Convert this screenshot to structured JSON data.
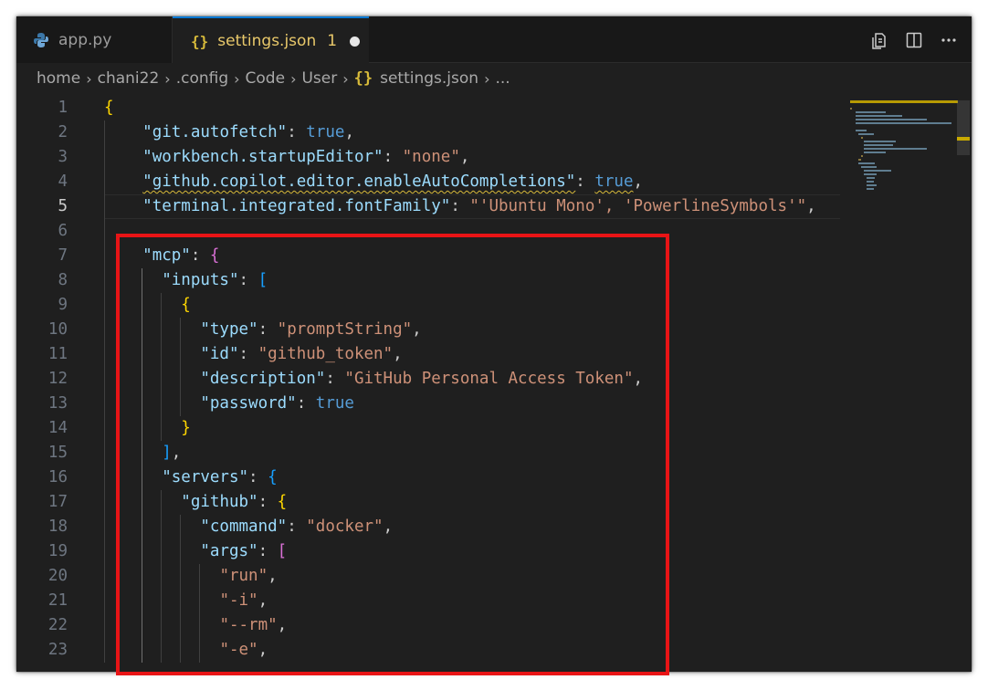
{
  "tabs": [
    {
      "label": "app.py",
      "icon": "python-icon",
      "active": false
    },
    {
      "label": "settings.json",
      "icon": "json-braces-icon",
      "problem_count": "1",
      "active": true,
      "dirty": true
    }
  ],
  "tab_actions": [
    "open-changes-icon",
    "split-editor-icon",
    "more-actions-icon"
  ],
  "breadcrumb": {
    "items": [
      "home",
      "chani22",
      ".config",
      "Code",
      "User"
    ],
    "file_icon": "{}",
    "file": "settings.json",
    "trailing": "..."
  },
  "editor": {
    "active_line": 5,
    "line_numbers": [
      "1",
      "2",
      "3",
      "4",
      "5",
      "6",
      "7",
      "8",
      "9",
      "10",
      "11",
      "12",
      "13",
      "14",
      "15",
      "16",
      "17",
      "18",
      "19",
      "20",
      "21",
      "22",
      "23"
    ],
    "lines": [
      "{",
      "    \"git.autofetch\": true,",
      "    \"workbench.startupEditor\": \"none\",",
      "    \"github.copilot.editor.enableAutoCompletions\": true,",
      "    \"terminal.integrated.fontFamily\": \"'Ubuntu Mono', 'PowerlineSymbols'\",",
      "",
      "    \"mcp\": {",
      "      \"inputs\": [",
      "        {",
      "          \"type\": \"promptString\",",
      "          \"id\": \"github_token\",",
      "          \"description\": \"GitHub Personal Access Token\",",
      "          \"password\": true",
      "        }",
      "      ],",
      "      \"servers\": {",
      "        \"github\": {",
      "          \"command\": \"docker\",",
      "          \"args\": [",
      "            \"run\",",
      "            \"-i\",",
      "            \"--rm\",",
      "            \"-e\","
    ]
  },
  "colors": {
    "background": "#1f1f1f",
    "key": "#9cdcfe",
    "string": "#ce9178",
    "boolean": "#569cd6",
    "highlight_box": "#e81416",
    "active_tab_border": "#0078d4"
  }
}
